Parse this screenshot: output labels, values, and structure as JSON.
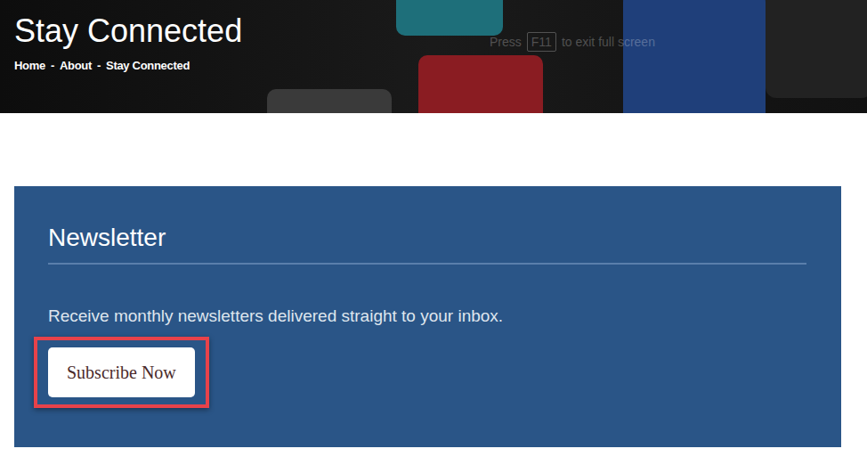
{
  "header": {
    "title": "Stay Connected",
    "breadcrumb": [
      {
        "label": "Home"
      },
      {
        "label": "About"
      },
      {
        "label": "Stay Connected"
      }
    ],
    "separator": "-"
  },
  "fullscreen_hint": {
    "before": "Press",
    "key": "F11",
    "after": "to exit full screen"
  },
  "newsletter": {
    "title": "Newsletter",
    "description": "Receive monthly newsletters delivered straight to your inbox.",
    "button": "Subscribe Now"
  }
}
